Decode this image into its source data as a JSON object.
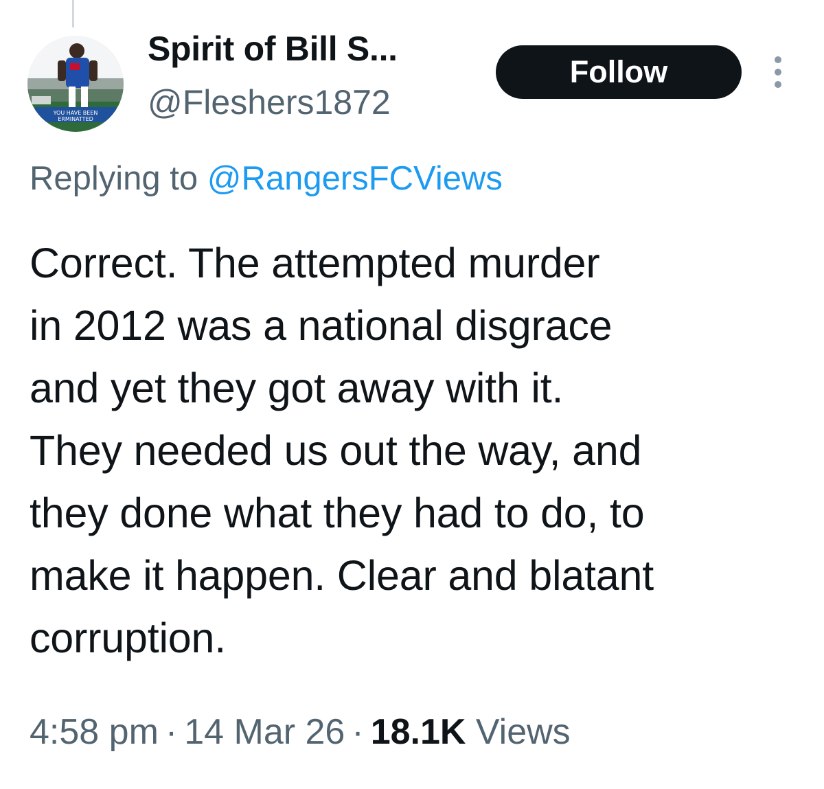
{
  "tweet": {
    "author": {
      "display_name": "Spirit of Bill S...",
      "handle": "@Fleshers1872",
      "avatar_caption": "YOU HAVE BEEN\nERMINATTED"
    },
    "follow_label": "Follow",
    "more_icon": "more-vertical-icon",
    "replying_prefix": "Replying to",
    "replying_to": "@RangersFCViews",
    "text": "Correct. The attempted murder\nin 2012 was a national disgrace\nand yet they got away with it.\nThey needed us out the way, and\nthey done what they had to do, to\nmake it happen. Clear and blatant\ncorruption.",
    "time": "4:58 pm",
    "separator": "·",
    "date": "14 Mar 26",
    "views_count": "18.1K",
    "views_label": "Views"
  },
  "colors": {
    "text_primary": "#0f1419",
    "text_secondary": "#536471",
    "link": "#1d9bf0",
    "button_bg": "#0f1419",
    "button_text": "#ffffff"
  }
}
